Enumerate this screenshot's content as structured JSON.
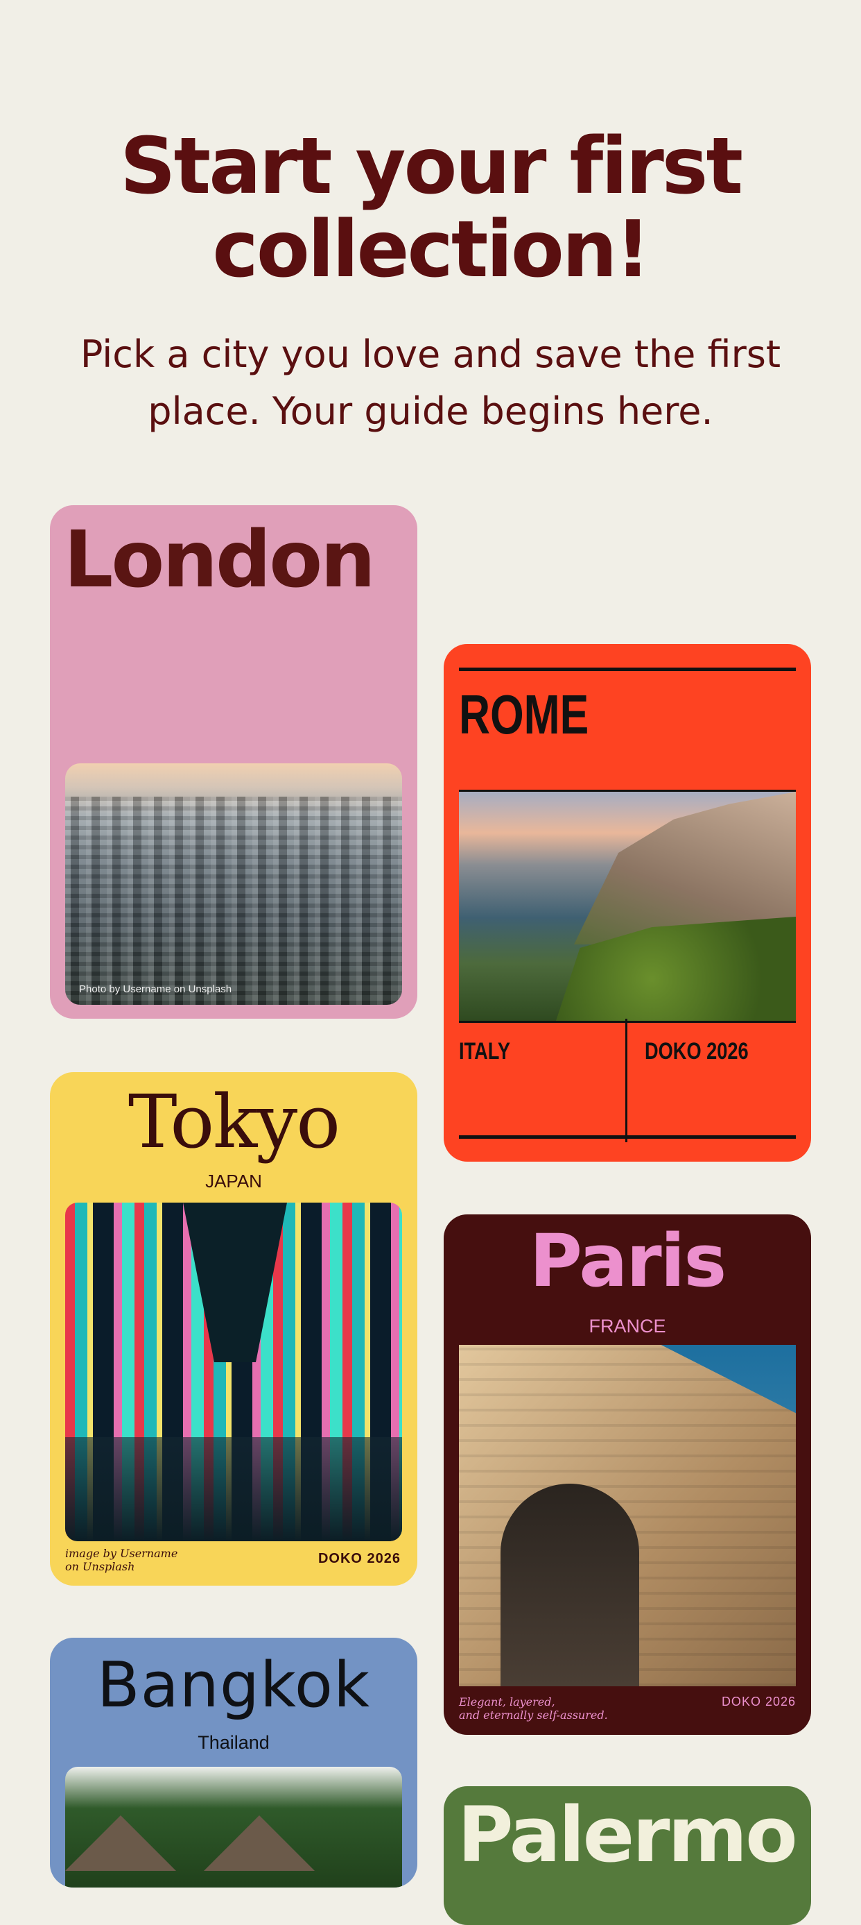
{
  "header": {
    "title_line1": "Start your first",
    "title_line2": "collection!",
    "subtitle_line1": "Pick a city you love and save the first",
    "subtitle_line2": "place. Your guide begins here."
  },
  "cards": {
    "london": {
      "city": "London",
      "credit": "Photo by Username on Unsplash",
      "bg": "#e09fb9"
    },
    "rome": {
      "city": "ROME",
      "country": "ITALY",
      "brand": "DOKO 2026",
      "bg": "#fe4322"
    },
    "tokyo": {
      "city": "Tokyo",
      "country": "JAPAN",
      "credit_line1": "image by Username",
      "credit_line2": "on Unsplash",
      "brand": "DOKO 2026",
      "bg": "#f8d558"
    },
    "paris": {
      "city": "Paris",
      "country": "FRANCE",
      "tagline_line1": "Elegant, layered,",
      "tagline_line2": "and eternally self-assured.",
      "brand": "DOKO 2026",
      "bg": "#460f0f"
    },
    "bangkok": {
      "city": "Bangkok",
      "country": "Thailand",
      "bg": "#7393c4"
    },
    "palermo": {
      "city": "Palermo",
      "bg": "#557a3c"
    }
  }
}
